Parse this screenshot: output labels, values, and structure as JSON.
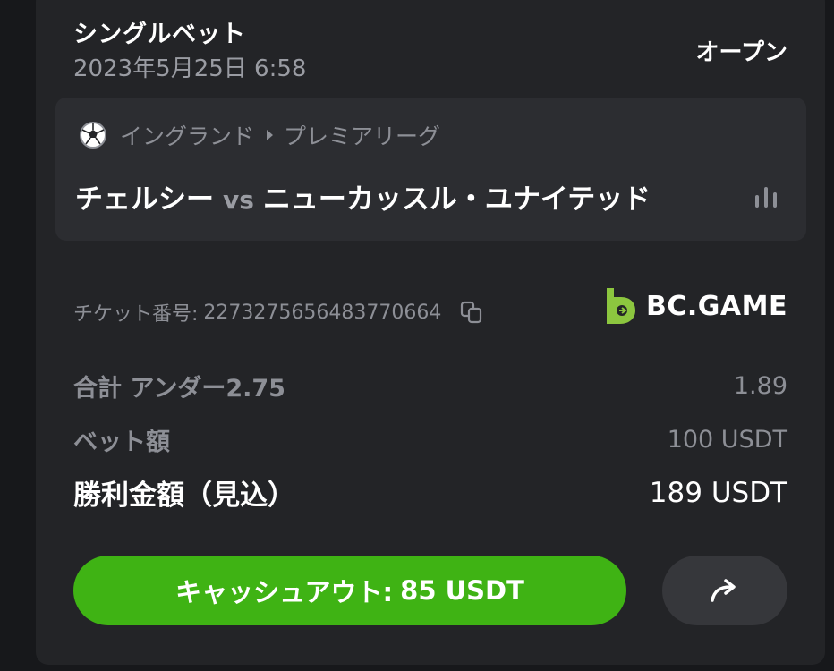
{
  "header": {
    "title": "シングルベット",
    "date": "2023年5月25日 6:58",
    "status": "オープン"
  },
  "match": {
    "league_country": "イングランド",
    "league_name": "プレミアリーグ",
    "home_team": "チェルシー",
    "vs": "vs",
    "away_team": "ニューカッスル・ユナイテッド",
    "sport_icon": "soccer-ball-icon",
    "stats_icon": "bar-chart-icon"
  },
  "ticket": {
    "label": "チケット番号:",
    "number": "227327565648377066​4",
    "copy_icon": "copy-icon"
  },
  "brand": {
    "name": "BC.GAME",
    "accent": "#8cc63f"
  },
  "bet_rows": [
    {
      "label": "合計 アンダー2.75",
      "value": "1.89"
    },
    {
      "label": "ベット額",
      "value": "100 USDT"
    },
    {
      "label": "勝利金額（見込）",
      "value": "189 USDT"
    }
  ],
  "actions": {
    "cashout_label": "キャッシュアウト:",
    "cashout_value": "85 USDT",
    "cashout_color": "#3fb314",
    "share_icon": "share-arrow-icon"
  }
}
